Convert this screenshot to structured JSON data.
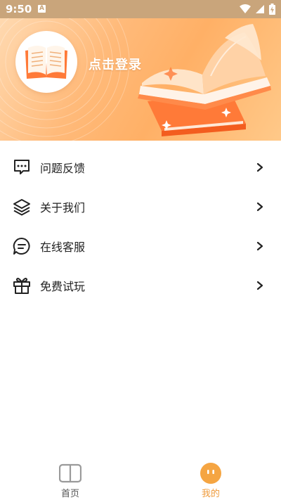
{
  "status_bar": {
    "time": "9:50",
    "notification_icon": "A"
  },
  "header": {
    "login_text": "点击登录"
  },
  "menu": {
    "items": [
      {
        "label": "问题反馈",
        "icon": "chat-bubble-icon"
      },
      {
        "label": "关于我们",
        "icon": "layers-icon"
      },
      {
        "label": "在线客服",
        "icon": "message-icon"
      },
      {
        "label": "免费试玩",
        "icon": "gift-icon"
      }
    ]
  },
  "bottom_nav": {
    "tabs": [
      {
        "label": "首页",
        "icon": "book-icon",
        "active": false
      },
      {
        "label": "我的",
        "icon": "profile-face-icon",
        "active": true
      }
    ]
  },
  "colors": {
    "accent": "#ef9a3a",
    "banner": "#ffb066",
    "status_bar": "#c9a57b"
  }
}
